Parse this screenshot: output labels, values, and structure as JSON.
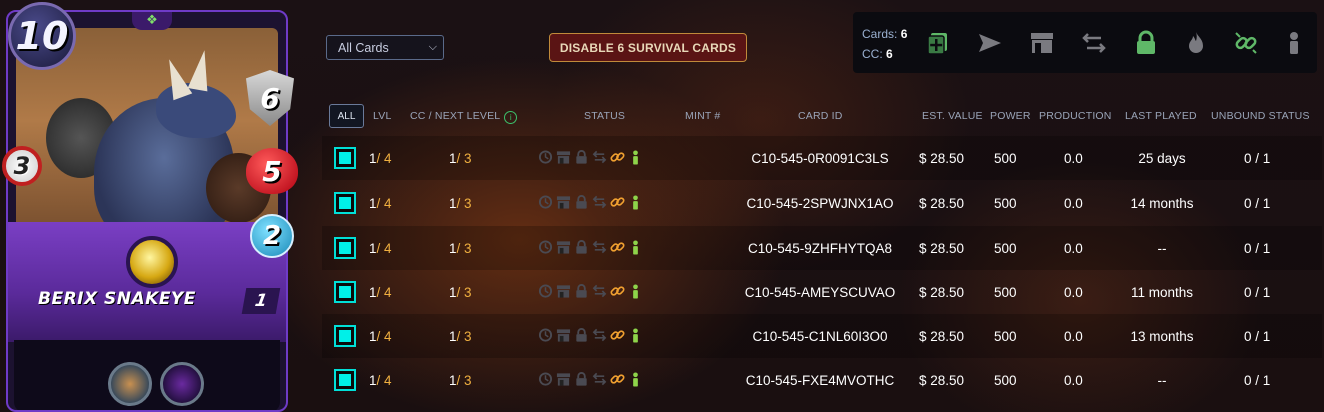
{
  "card": {
    "name": "BERIX SNAKEYE",
    "mana": "10",
    "armor": "6",
    "health": "5",
    "speed": "2",
    "attack": "3",
    "level": "1"
  },
  "filter": {
    "selected": "All Cards"
  },
  "disable_button": "DISABLE 6 SURVIVAL CARDS",
  "summary": {
    "cards_label": "Cards:",
    "cards_value": "6",
    "cc_label": "CC:",
    "cc_value": "6"
  },
  "toolbar_icons": [
    "combine-icon",
    "send-icon",
    "market-icon",
    "transfer-icon",
    "lock-icon",
    "burn-icon",
    "unbind-icon",
    "delegate-icon"
  ],
  "headers": {
    "all": "ALL",
    "lvl": "LVL",
    "cc": "CC / NEXT LEVEL",
    "status": "STATUS",
    "mint": "MINT #",
    "card_id": "CARD ID",
    "value": "EST. VALUE",
    "power": "POWER",
    "production": "PRODUCTION",
    "last_played": "LAST PLAYED",
    "unbound": "UNBOUND STATUS"
  },
  "colors": {
    "accent_cyan": "#00f0e8",
    "level_orange": "#f0b040",
    "link_orange": "#f0a030",
    "person_green": "#8ed44a"
  },
  "rows": [
    {
      "lvl_cur": "1",
      "lvl_tot": " / 4",
      "cc_cur": "1",
      "cc_tot": " / 3",
      "mint": "",
      "card_id": "C10-545-0R0091C3LS",
      "value": "$ 28.50",
      "power": "500",
      "production": "0.0",
      "last_played": "25 days",
      "unbound": "0 / 1"
    },
    {
      "lvl_cur": "1",
      "lvl_tot": " / 4",
      "cc_cur": "1",
      "cc_tot": " / 3",
      "mint": "",
      "card_id": "C10-545-2SPWJNX1AO",
      "value": "$ 28.50",
      "power": "500",
      "production": "0.0",
      "last_played": "14 months",
      "unbound": "0 / 1"
    },
    {
      "lvl_cur": "1",
      "lvl_tot": " / 4",
      "cc_cur": "1",
      "cc_tot": " / 3",
      "mint": "",
      "card_id": "C10-545-9ZHFHYTQA8",
      "value": "$ 28.50",
      "power": "500",
      "production": "0.0",
      "last_played": "--",
      "unbound": "0 / 1"
    },
    {
      "lvl_cur": "1",
      "lvl_tot": " / 4",
      "cc_cur": "1",
      "cc_tot": " / 3",
      "mint": "",
      "card_id": "C10-545-AMEYSCUVAO",
      "value": "$ 28.50",
      "power": "500",
      "production": "0.0",
      "last_played": "11 months",
      "unbound": "0 / 1"
    },
    {
      "lvl_cur": "1",
      "lvl_tot": " / 4",
      "cc_cur": "1",
      "cc_tot": " / 3",
      "mint": "",
      "card_id": "C10-545-C1NL60I3O0",
      "value": "$ 28.50",
      "power": "500",
      "production": "0.0",
      "last_played": "13 months",
      "unbound": "0 / 1"
    },
    {
      "lvl_cur": "1",
      "lvl_tot": " / 4",
      "cc_cur": "1",
      "cc_tot": " / 3",
      "mint": "",
      "card_id": "C10-545-FXE4MVOTHC",
      "value": "$ 28.50",
      "power": "500",
      "production": "0.0",
      "last_played": "--",
      "unbound": "0 / 1"
    }
  ]
}
